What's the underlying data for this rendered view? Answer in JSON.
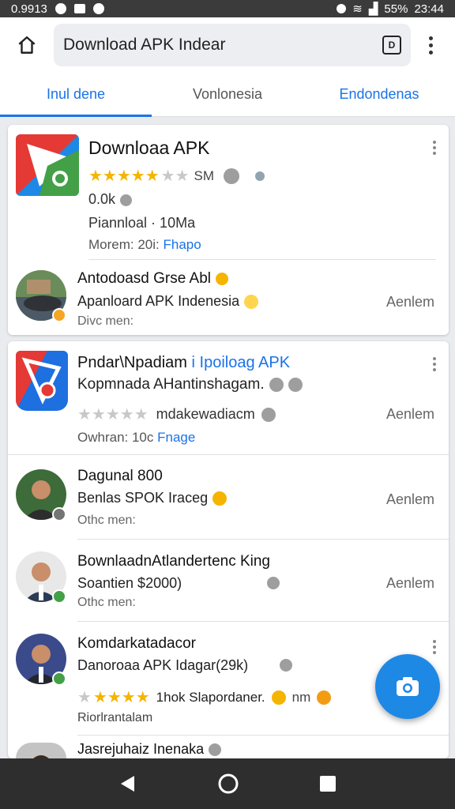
{
  "status": {
    "left_text": "0.9913",
    "battery": "55%",
    "time": "23:44"
  },
  "toolbar": {
    "url": "Download APK Indear"
  },
  "tabs": [
    {
      "label": "Inul dene"
    },
    {
      "label": "Vonlonesia"
    },
    {
      "label": "Endondenas"
    }
  ],
  "featured": {
    "title": "Downloaa APK",
    "rating_extra": "SM",
    "downloads": "0.0k",
    "dev_line": "Piannloal · 10Ma",
    "more_label": "Morem: 20i:",
    "more_link": "Fhapo"
  },
  "featured_row": {
    "name": "Antodoasd Grse Abl",
    "sub": "Apanloard APK Indenesia",
    "more": "Divc men:",
    "action": "Aenlem"
  },
  "card2_app": {
    "title_a": "Pndar\\Npadiam",
    "title_link": "i Ipoiloag APK",
    "line2": "Kopmnada AHantinshagam.",
    "rating_text": "mdakewadiacm",
    "action": "Aenlem",
    "more_label": "Owhran: 10c",
    "more_link": "Fnage"
  },
  "rows": [
    {
      "name": "Dagunal 800",
      "sub": "Benlas SPOK Iraceg",
      "more": "Othc men:",
      "action": "Aenlem"
    },
    {
      "name": "BownlaadnAtlandertenc King",
      "sub": "Soantien $2000)",
      "more": "Othc men:",
      "action": "Aenlem"
    },
    {
      "name": "Komdarkatadacor",
      "sub": "Danoroaa APK Idagar(29k)",
      "rating_text": "1hok Slapordaner.",
      "rating_extra": "nm",
      "more": "Riorlrantalam",
      "action": ""
    },
    {
      "name": "Jasrejuhaiz Inenaka",
      "sub": "",
      "more": "",
      "action": ""
    }
  ],
  "colors": {
    "accent": "#1a73e8",
    "fab": "#1e88e5",
    "star": "#f5b400"
  },
  "icons": {
    "fab": "camera-icon",
    "home": "home-icon",
    "tab": "tab-switcher-icon"
  }
}
